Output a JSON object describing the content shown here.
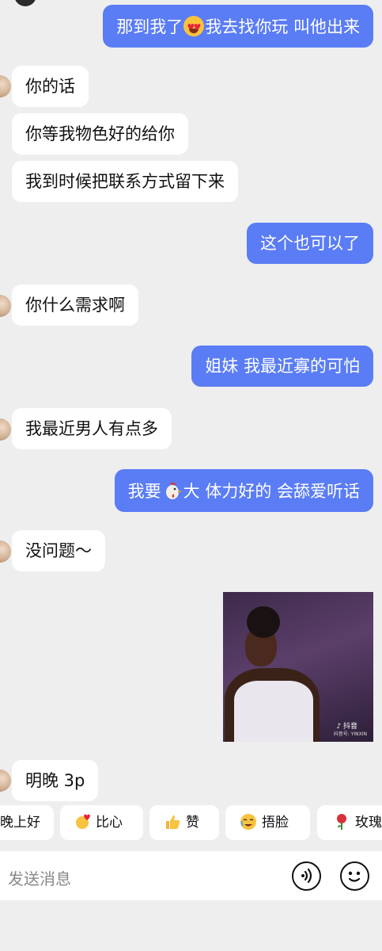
{
  "chat": {
    "messages": [
      {
        "side": "out",
        "text_before": "那到我了",
        "emoji": "star-struck-emoji",
        "text_after": "我去找你玩 叫他出来"
      },
      {
        "side": "in",
        "text": "你的话"
      },
      {
        "side": "in",
        "text": "你等我物色好的给你"
      },
      {
        "side": "in",
        "text": "我到时候把联系方式留下来"
      },
      {
        "side": "out",
        "text": "这个也可以了"
      },
      {
        "side": "in",
        "text": "你什么需求啊"
      },
      {
        "side": "out",
        "text": "姐妹 我最近寡的可怕"
      },
      {
        "side": "in",
        "text": "我最近男人有点多"
      },
      {
        "side": "out",
        "text_before": "我要",
        "emoji": "chicken-emoji",
        "text_after": "大 体力好的 会舔爱听话"
      },
      {
        "side": "in",
        "text": "没问题～"
      },
      {
        "side": "in",
        "type": "video-thumbnail"
      },
      {
        "side": "in",
        "text": "明晚 3p"
      }
    ],
    "photo_overlay": {
      "tiktok_label": "♪ 抖音",
      "watermark": "抖音号: YINXIN"
    }
  },
  "quick_replies": [
    {
      "label": "晚上好",
      "icon": "moon-icon"
    },
    {
      "label": "比心",
      "icon": "finger-heart-icon"
    },
    {
      "label": "赞",
      "icon": "thumbs-up-icon"
    },
    {
      "label": "捂脸",
      "icon": "facepalm-icon"
    },
    {
      "label": "玫瑰",
      "icon": "rose-icon"
    }
  ],
  "input": {
    "placeholder": "发送消息"
  },
  "colors": {
    "background": "#eeeeef",
    "outgoing_bubble": "#5a7cf5",
    "incoming_bubble": "#ffffff"
  }
}
